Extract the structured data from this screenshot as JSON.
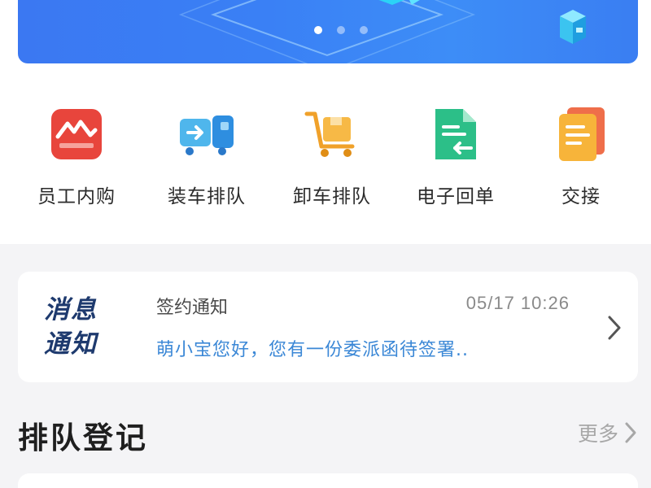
{
  "banner": {
    "slide_count": 3,
    "active_slide": 1
  },
  "colors": {
    "banner_blue": "#3a80f5",
    "message_link": "#3a87d6",
    "logo_navy": "#1e3a6e"
  },
  "quick_actions": [
    {
      "label": "员工内购",
      "icon": "employee-shop-icon"
    },
    {
      "label": "装车排队",
      "icon": "loading-truck-icon"
    },
    {
      "label": "卸车排队",
      "icon": "unloading-cart-icon"
    },
    {
      "label": "电子回单",
      "icon": "e-receipt-icon"
    },
    {
      "label": "交接",
      "icon": "handover-doc-icon"
    }
  ],
  "message": {
    "logo_line1": "消息",
    "logo_line2": "通知",
    "type": "签约通知",
    "time": "05/17 10:26",
    "body": "萌小宝您好，您有一份委派函待签署.."
  },
  "queue_section": {
    "title": "排队登记",
    "more": "更多"
  }
}
